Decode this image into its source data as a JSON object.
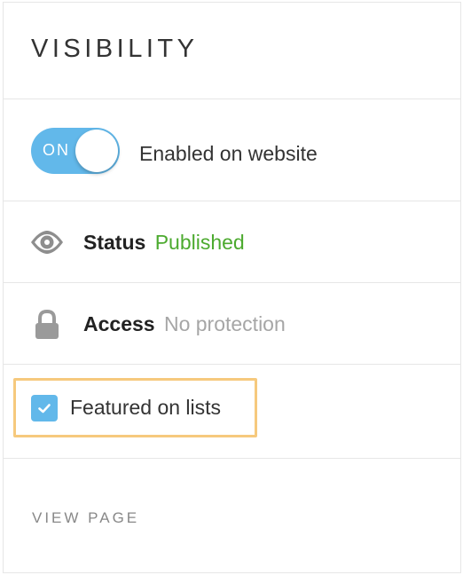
{
  "panel": {
    "title": "VISIBILITY"
  },
  "toggle": {
    "state_label": "ON",
    "is_on": true,
    "label": "Enabled on website"
  },
  "status": {
    "icon": "eye-icon",
    "label": "Status",
    "value": "Published",
    "value_color": "#4caa2f"
  },
  "access": {
    "icon": "lock-icon",
    "label": "Access",
    "value": "No protection",
    "value_color": "#a6a6a6"
  },
  "featured": {
    "checked": true,
    "label": "Featured on lists",
    "highlight_color": "#f6c97d"
  },
  "view_page": {
    "label": "VIEW PAGE"
  },
  "colors": {
    "accent": "#62b8ea",
    "border": "#e6e6e6"
  }
}
